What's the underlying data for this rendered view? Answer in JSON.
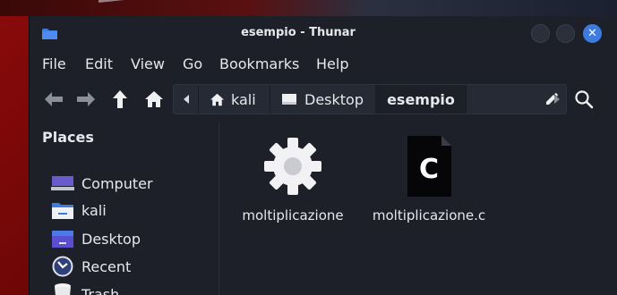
{
  "window": {
    "title": "esempio - Thunar",
    "close_symbol": "✕",
    "icons": {
      "title": "folder-icon",
      "minimize": "minimize-button",
      "maximize": "maximize-button",
      "close": "close-icon"
    }
  },
  "menubar": {
    "items": [
      "File",
      "Edit",
      "View",
      "Go",
      "Bookmarks",
      "Help"
    ]
  },
  "toolbar": {
    "icons": [
      "back-arrow-icon",
      "forward-arrow-icon",
      "up-arrow-icon",
      "home-icon",
      "search-icon"
    ],
    "path": [
      {
        "label": "kali",
        "icon": "home-icon"
      },
      {
        "label": "Desktop",
        "icon": "desktop-icon"
      },
      {
        "label": "esempio",
        "icon": ""
      }
    ]
  },
  "sidebar": {
    "header": "Places",
    "items": [
      {
        "label": "Computer",
        "icon": "computer-icon"
      },
      {
        "label": "kali",
        "icon": "home-folder-icon"
      },
      {
        "label": "Desktop",
        "icon": "desktop-folder-icon"
      },
      {
        "label": "Recent",
        "icon": "recent-icon"
      },
      {
        "label": "Trash",
        "icon": "trash-icon"
      }
    ]
  },
  "files": [
    {
      "name": "moltiplicazione",
      "icon": "executable-gear-icon"
    },
    {
      "name": "moltiplicazione.c",
      "icon": "c-source-file-icon",
      "icon_letter": "C"
    }
  ],
  "colors": {
    "accent": "#3e7be0",
    "window_bg": "#1d2029",
    "pathbar_bg": "#262a35"
  }
}
